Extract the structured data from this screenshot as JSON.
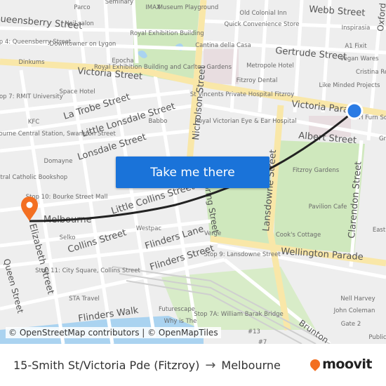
{
  "map": {
    "streets": [
      "Webb Street",
      "Gertrude Street",
      "Victoria Street",
      "Victoria Parade",
      "Albert Street",
      "La Trobe Street",
      "Little Lonsdale Street",
      "Lonsdale Street",
      "Little Collins Street",
      "Collins Street",
      "Flinders Lane",
      "Flinders Street",
      "Wellington Parade",
      "Nicholson Street",
      "Lansdowne Street",
      "Clarendon Street",
      "Elizabeth Street",
      "Queensberry Street",
      "Flinders Walk",
      "Brunton",
      "Oxford",
      "Queen Street",
      "Spring Street"
    ],
    "pois": [
      "Parco",
      "Seminary",
      "IMAX",
      "Museum Playground",
      "Old Colonial Inn",
      "Nail salon",
      "Quick Convenience Store",
      "Inspirasia",
      "Stop 4: Queensberry Street",
      "Downtowner on Lygon",
      "Royal Exhibition Building",
      "Cantina della Casa",
      "A1 Fixit",
      "Vegan Wares",
      "Dinkums",
      "Epocha",
      "Royal Exhibition Building and Carlton Gardens",
      "Metropole Hotel",
      "Cristina Re",
      "Fitzroy Dental",
      "Like Minded Projects",
      "Space Hotel",
      "St Vincents Private Hospital Fitzroy",
      "Stop 7: RMIT University",
      "Babbo",
      "Royal Victorian Eye & Ear Hospital",
      "KFC",
      "Stop 6: Melbourne Central Station, Swanston Street",
      "Domayne",
      "Fitzroy Gardens",
      "Central Catholic Bookshop",
      "Stop 10: Bourke Street Mall",
      "Melbourne",
      "Pavilion Cafe",
      "Westpac",
      "Verge",
      "Selko",
      "Cook's Cottage",
      "Stop 9: Lansdowne Street",
      "Stop 11: City Square, Collins Street",
      "STA Travel",
      "Futurescape",
      "Why is The",
      "Stop 7A: William Barak Bridge",
      "Nell Harvey",
      "John Coleman",
      "Gate 2",
      "Public",
      "#13",
      "#7",
      "MH Furn Solution",
      "East",
      "Gr"
    ],
    "origin_color": "#2a7be4",
    "destination_color": "#f36f21",
    "route_color": "#222222"
  },
  "cta": {
    "label": "Take me there"
  },
  "attribution": "© OpenStreetMap contributors | © OpenMapTiles",
  "footer": {
    "origin": "15-Smith St/Victoria Pde (Fitzroy)",
    "arrow": "→",
    "destination": "Melbourne",
    "logo_text": "moovit"
  }
}
